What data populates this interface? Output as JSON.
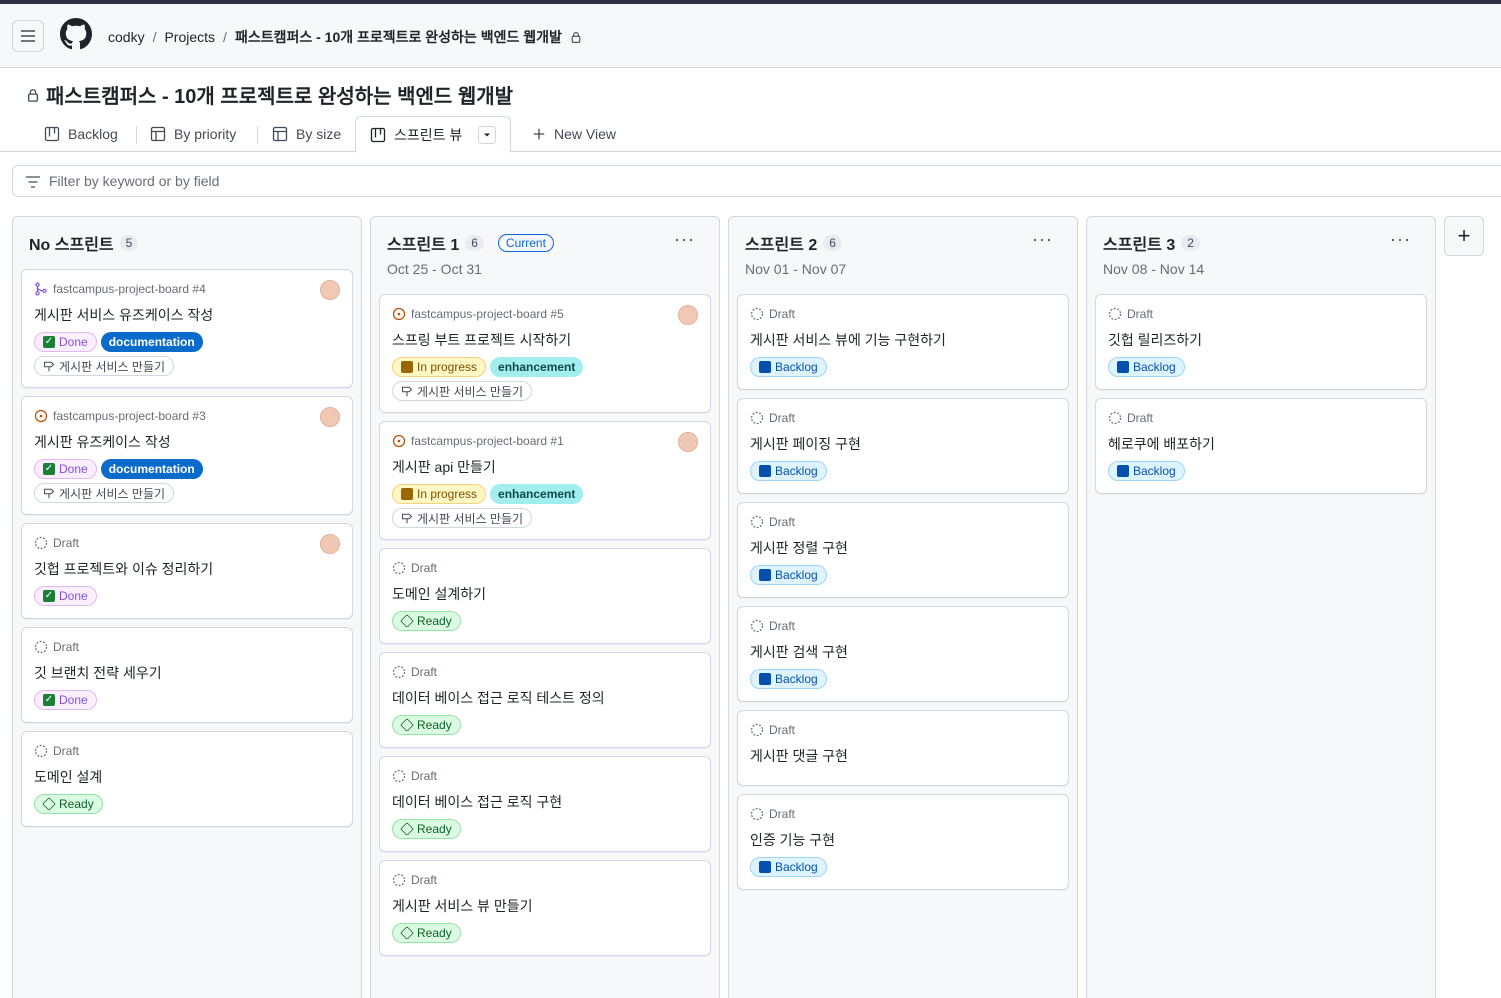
{
  "breadcrumb": {
    "owner": "codky",
    "section": "Projects",
    "project": "패스트캠퍼스 - 10개 프로젝트로 완성하는 백엔드 웹개발"
  },
  "page_title": "패스트캠퍼스 - 10개 프로젝트로 완성하는 백엔드 웹개발",
  "tabs": [
    {
      "label": "Backlog",
      "icon": "board-icon"
    },
    {
      "label": "By priority",
      "icon": "table-icon"
    },
    {
      "label": "By size",
      "icon": "table-icon"
    },
    {
      "label": "스프린트 뷰",
      "icon": "board-icon",
      "active": true
    }
  ],
  "new_view_label": "New View",
  "filter_placeholder": "Filter by keyword or by field",
  "columns": [
    {
      "title": "No 스프린트",
      "count": "5",
      "dates": "",
      "current": "",
      "cards": [
        {
          "kind": "pr",
          "meta": "fastcampus-project-board #4",
          "title": "게시판 서비스 유즈케이스 작성",
          "labels": [
            "Done",
            "documentation"
          ],
          "milestone": "게시판 서비스 만들기",
          "avatar": true
        },
        {
          "kind": "issue",
          "meta": "fastcampus-project-board #3",
          "title": "게시판 유즈케이스 작성",
          "labels": [
            "Done",
            "documentation"
          ],
          "milestone": "게시판 서비스 만들기",
          "avatar": true
        },
        {
          "kind": "draft",
          "meta": "Draft",
          "title": "깃헙 프로젝트와 이슈 정리하기",
          "labels": [
            "Done"
          ],
          "avatar": true
        },
        {
          "kind": "draft",
          "meta": "Draft",
          "title": "깃 브랜치 전략 세우기",
          "labels": [
            "Done"
          ]
        },
        {
          "kind": "draft",
          "meta": "Draft",
          "title": "도메인 설계",
          "labels": [
            "Ready"
          ]
        }
      ]
    },
    {
      "title": "스프린트 1",
      "count": "6",
      "dates": "Oct 25 - Oct 31",
      "current": "Current",
      "cards": [
        {
          "kind": "issue",
          "meta": "fastcampus-project-board #5",
          "title": "스프링 부트 프로젝트 시작하기",
          "labels": [
            "In progress",
            "enhancement"
          ],
          "milestone": "게시판 서비스 만들기",
          "avatar": true
        },
        {
          "kind": "issue",
          "meta": "fastcampus-project-board #1",
          "title": "게시판 api 만들기",
          "labels": [
            "In progress",
            "enhancement"
          ],
          "milestone": "게시판 서비스 만들기",
          "avatar": true
        },
        {
          "kind": "draft",
          "meta": "Draft",
          "title": "도메인 설계하기",
          "labels": [
            "Ready"
          ]
        },
        {
          "kind": "draft",
          "meta": "Draft",
          "title": "데이터 베이스 접근 로직 테스트 정의",
          "labels": [
            "Ready"
          ]
        },
        {
          "kind": "draft",
          "meta": "Draft",
          "title": "데이터 베이스 접근 로직 구현",
          "labels": [
            "Ready"
          ]
        },
        {
          "kind": "draft",
          "meta": "Draft",
          "title": "게시판 서비스 뷰 만들기",
          "labels": [
            "Ready"
          ]
        }
      ]
    },
    {
      "title": "스프린트 2",
      "count": "6",
      "dates": "Nov 01 - Nov 07",
      "current": "",
      "cards": [
        {
          "kind": "draft",
          "meta": "Draft",
          "title": "게시판 서비스 뷰에 기능 구현하기",
          "labels": [
            "Backlog"
          ]
        },
        {
          "kind": "draft",
          "meta": "Draft",
          "title": "게시판 페이징 구현",
          "labels": [
            "Backlog"
          ]
        },
        {
          "kind": "draft",
          "meta": "Draft",
          "title": "게시판 정렬 구현",
          "labels": [
            "Backlog"
          ]
        },
        {
          "kind": "draft",
          "meta": "Draft",
          "title": "게시판 검색 구현",
          "labels": [
            "Backlog"
          ]
        },
        {
          "kind": "draft",
          "meta": "Draft",
          "title": "게시판 댓글 구현",
          "labels": []
        },
        {
          "kind": "draft",
          "meta": "Draft",
          "title": "인증 기능 구현",
          "labels": [
            "Backlog"
          ]
        }
      ]
    },
    {
      "title": "스프린트 3",
      "count": "2",
      "dates": "Nov 08 - Nov 14",
      "current": "",
      "cards": [
        {
          "kind": "draft",
          "meta": "Draft",
          "title": "깃헙 릴리즈하기",
          "labels": [
            "Backlog"
          ]
        },
        {
          "kind": "draft",
          "meta": "Draft",
          "title": "헤로쿠에 배포하기",
          "labels": [
            "Backlog"
          ]
        }
      ]
    }
  ],
  "colors": {
    "accent": "#0969da",
    "done": "#8250df",
    "ready": "#1a7f37",
    "progress": "#9a6700"
  }
}
